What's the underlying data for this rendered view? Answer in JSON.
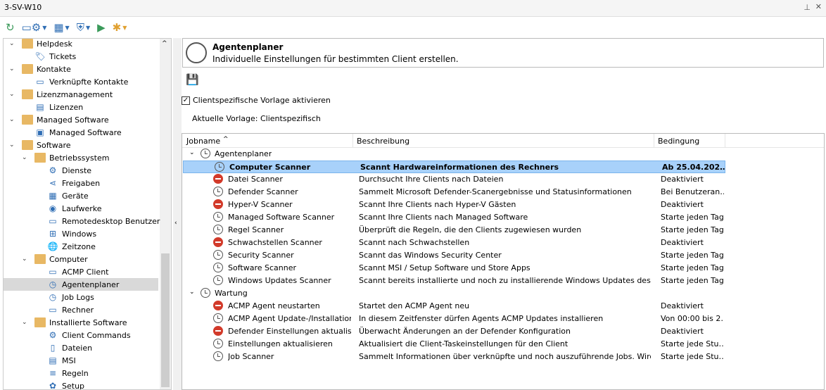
{
  "window": {
    "title": "3-SV-W10",
    "pin_icon": "pin-icon",
    "close_icon": "close-icon"
  },
  "sidebar": {
    "items": [
      {
        "label": "Helpdesk",
        "level": 0,
        "icon": "folder"
      },
      {
        "label": "Tickets",
        "level": 1,
        "icon": "tag"
      },
      {
        "label": "Kontakte",
        "level": 0,
        "icon": "folder"
      },
      {
        "label": "Verknüpfte Kontakte",
        "level": 1,
        "icon": "monitor-user"
      },
      {
        "label": "Lizenzmanagement",
        "level": 0,
        "icon": "folder"
      },
      {
        "label": "Lizenzen",
        "level": 1,
        "icon": "certificate"
      },
      {
        "label": "Managed Software",
        "level": 0,
        "icon": "folder"
      },
      {
        "label": "Managed Software",
        "level": 1,
        "icon": "package"
      },
      {
        "label": "Software",
        "level": 0,
        "icon": "folder"
      },
      {
        "label": "Betriebssystem",
        "level": 1,
        "icon": "folder"
      },
      {
        "label": "Dienste",
        "level": 2,
        "icon": "gear"
      },
      {
        "label": "Freigaben",
        "level": 2,
        "icon": "share"
      },
      {
        "label": "Geräte",
        "level": 2,
        "icon": "devices"
      },
      {
        "label": "Laufwerke",
        "level": 2,
        "icon": "drive"
      },
      {
        "label": "Remotedesktop Benutzer",
        "level": 2,
        "icon": "remote-user"
      },
      {
        "label": "Windows",
        "level": 2,
        "icon": "windows"
      },
      {
        "label": "Zeitzone",
        "level": 2,
        "icon": "globe"
      },
      {
        "label": "Computer",
        "level": 1,
        "icon": "folder"
      },
      {
        "label": "ACMP Client",
        "level": 2,
        "icon": "monitor"
      },
      {
        "label": "Agentenplaner",
        "level": 2,
        "icon": "clock",
        "selected": true
      },
      {
        "label": "Job Logs",
        "level": 2,
        "icon": "clock"
      },
      {
        "label": "Rechner",
        "level": 2,
        "icon": "monitor"
      },
      {
        "label": "Installierte Software",
        "level": 1,
        "icon": "folder"
      },
      {
        "label": "Client Commands",
        "level": 2,
        "icon": "gear"
      },
      {
        "label": "Dateien",
        "level": 2,
        "icon": "file"
      },
      {
        "label": "MSI",
        "level": 2,
        "icon": "msi"
      },
      {
        "label": "Regeln",
        "level": 2,
        "icon": "rules"
      },
      {
        "label": "Setup",
        "level": 2,
        "icon": "setup"
      }
    ]
  },
  "header": {
    "title": "Agentenplaner",
    "subtitle": "Individuelle Einstellungen für bestimmten Client erstellen."
  },
  "checkbox": {
    "label": "Clientspezifische Vorlage aktivieren",
    "checked": true
  },
  "vorlage": "Aktuelle Vorlage: Clientspezifisch",
  "table": {
    "columns": [
      "Jobname",
      "Beschreibung",
      "Bedingung"
    ],
    "groups": [
      {
        "name": "Agentenplaner",
        "rows": [
          {
            "name": "Computer Scanner",
            "desc": "Scannt Hardwareinformationen des Rechners",
            "cond": "Ab 25.04.202…",
            "status": "clock",
            "selected": true
          },
          {
            "name": "Datei Scanner",
            "desc": "Durchsucht Ihre Clients nach Dateien",
            "cond": "Deaktiviert",
            "status": "stop"
          },
          {
            "name": "Defender Scanner",
            "desc": "Sammelt Microsoft Defender-Scanergebnisse und Statusinformationen",
            "cond": "Bei Benutzeran…",
            "status": "clock"
          },
          {
            "name": "Hyper-V Scanner",
            "desc": "Scannt Ihre Clients nach Hyper-V Gästen",
            "cond": "Deaktiviert",
            "status": "stop"
          },
          {
            "name": "Managed Software Scanner",
            "desc": "Scannt Ihre Clients nach Managed Software",
            "cond": "Starte jeden Tag",
            "status": "clock"
          },
          {
            "name": "Regel Scanner",
            "desc": "Überprüft die Regeln, die den Clients zugewiesen wurden",
            "cond": "Starte jeden Tag",
            "status": "clock"
          },
          {
            "name": "Schwachstellen Scanner",
            "desc": "Scannt nach Schwachstellen",
            "cond": "Deaktiviert",
            "status": "stop"
          },
          {
            "name": "Security Scanner",
            "desc": "Scannt das Windows Security Center",
            "cond": "Starte jeden Tag",
            "status": "clock"
          },
          {
            "name": "Software Scanner",
            "desc": "Scannt MSI / Setup Software und Store Apps",
            "cond": "Starte jeden Tag",
            "status": "clock"
          },
          {
            "name": "Windows Updates Scanner",
            "desc": "Scannt bereits installierte und noch zu installierende Windows Updates des Rechners",
            "cond": "Starte jeden Tag",
            "status": "clock"
          }
        ]
      },
      {
        "name": "Wartung",
        "rows": [
          {
            "name": "ACMP Agent neustarten",
            "desc": "Startet den ACMP Agent neu",
            "cond": "Deaktiviert",
            "status": "stop"
          },
          {
            "name": "ACMP Agent Update-/Installation…",
            "desc": "In diesem Zeitfenster dürfen Agents ACMP Updates installieren",
            "cond": "Von 00:00 bis 2…",
            "status": "clock"
          },
          {
            "name": "Defender Einstellungen aktualisie…",
            "desc": "Überwacht Änderungen an der Defender Konfiguration",
            "cond": "Deaktiviert",
            "status": "stop"
          },
          {
            "name": "Einstellungen aktualisieren",
            "desc": "Aktualisiert die Client-Taskeinstellungen für den Client",
            "cond": "Starte jede Stu…",
            "status": "clock"
          },
          {
            "name": "Job Scanner",
            "desc": "Sammelt Informationen über verknüpfte und noch auszuführende Jobs. Wird auch b…",
            "cond": "Starte jede Stu…",
            "status": "clock"
          }
        ]
      }
    ]
  }
}
